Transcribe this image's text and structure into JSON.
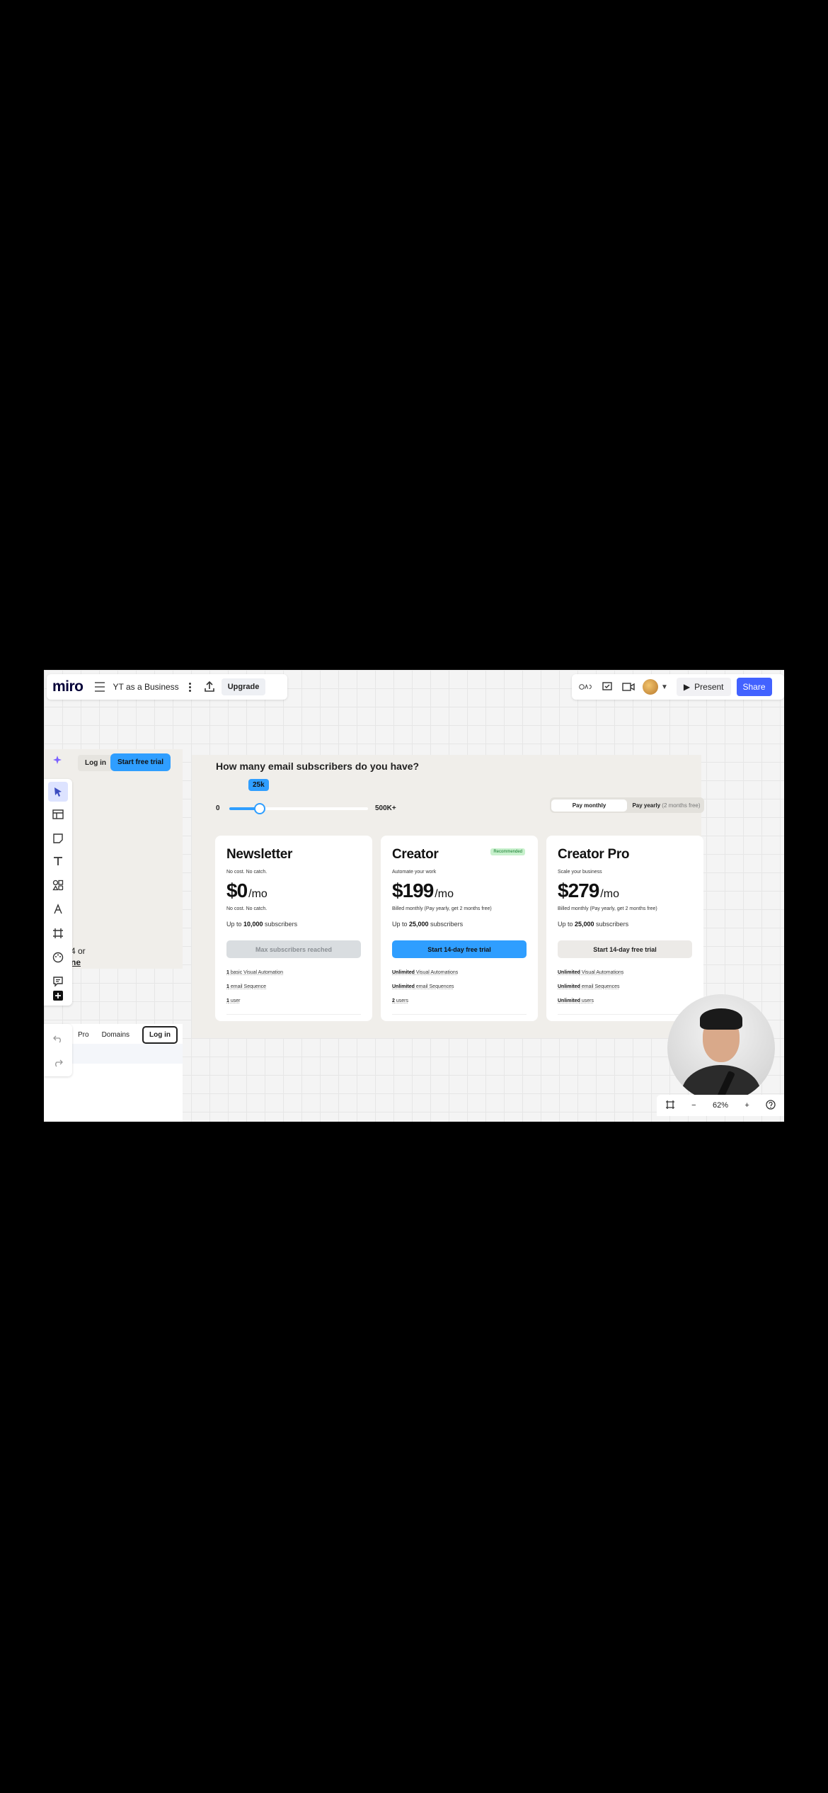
{
  "topbar": {
    "logo": "miro",
    "board_title": "YT as a Business",
    "upgrade_label": "Upgrade",
    "present_label": "Present",
    "share_label": "Share"
  },
  "left_frame": {
    "login_label": "Log in",
    "trial_label": "Start free trial",
    "frag1": "4 or",
    "frag2": "ne"
  },
  "left_nav": {
    "pro_label": "Pro",
    "domains_label": "Domains",
    "login_label": "Log in"
  },
  "pricing": {
    "question": "How many email subscribers do you have?",
    "slider": {
      "value_label": "25k",
      "min_label": "0",
      "max_label": "500K+",
      "fraction": 0.22
    },
    "billing": {
      "monthly": "Pay monthly",
      "yearly": "Pay yearly",
      "yearly_note": "(2 months free)"
    },
    "cards": [
      {
        "title": "Newsletter",
        "tagline": "No cost. No catch.",
        "badge": "",
        "price": "$0",
        "per": "/mo",
        "billed": "No cost. No catch.",
        "subs_prefix": "Up to ",
        "subs_count": "10,000",
        "subs_suffix": " subscribers",
        "cta": "Max subscribers reached",
        "features": [
          {
            "b": "1",
            "t": " basic Visual Automation"
          },
          {
            "b": "1",
            "t": " email Sequence"
          },
          {
            "b": "1",
            "t": " user"
          }
        ]
      },
      {
        "title": "Creator",
        "tagline": "Automate your work",
        "badge": "Recommended",
        "price": "$199",
        "per": "/mo",
        "billed": "Billed monthly (Pay yearly, get 2 months free)",
        "subs_prefix": "Up to ",
        "subs_count": "25,000",
        "subs_suffix": " subscribers",
        "cta": "Start 14-day free trial",
        "features": [
          {
            "b": "Unlimited",
            "t": " Visual Automations"
          },
          {
            "b": "Unlimited",
            "t": " email Sequences"
          },
          {
            "b": "2",
            "t": " users"
          }
        ]
      },
      {
        "title": "Creator Pro",
        "tagline": "Scale your business",
        "badge": "",
        "price": "$279",
        "per": "/mo",
        "billed": "Billed monthly (Pay yearly, get 2 months free)",
        "subs_prefix": "Up to ",
        "subs_count": "25,000",
        "subs_suffix": " subscribers",
        "cta": "Start 14-day free trial",
        "features": [
          {
            "b": "Unlimited",
            "t": " Visual Automations"
          },
          {
            "b": "Unlimited",
            "t": " email Sequences"
          },
          {
            "b": "Unlimited",
            "t": " users"
          }
        ]
      }
    ]
  },
  "zoom": {
    "level": "62%"
  },
  "colors": {
    "accent": "#4262ff",
    "cta_blue": "#2f9eff",
    "frame_bg": "#f0eeea"
  },
  "icons": [
    "menu-icon",
    "kebab-icon",
    "upload-icon",
    "reactions-icon",
    "comment-icon",
    "video-icon",
    "play-icon",
    "ai-sparkle-icon",
    "select-cursor-icon",
    "table-icon",
    "sticky-note-icon",
    "text-icon",
    "shapes-icon",
    "pen-icon",
    "frame-icon",
    "palette-icon",
    "comment-tool-icon",
    "add-icon",
    "undo-icon",
    "redo-icon",
    "fit-view-icon",
    "zoom-out-icon",
    "zoom-in-icon",
    "help-icon"
  ]
}
